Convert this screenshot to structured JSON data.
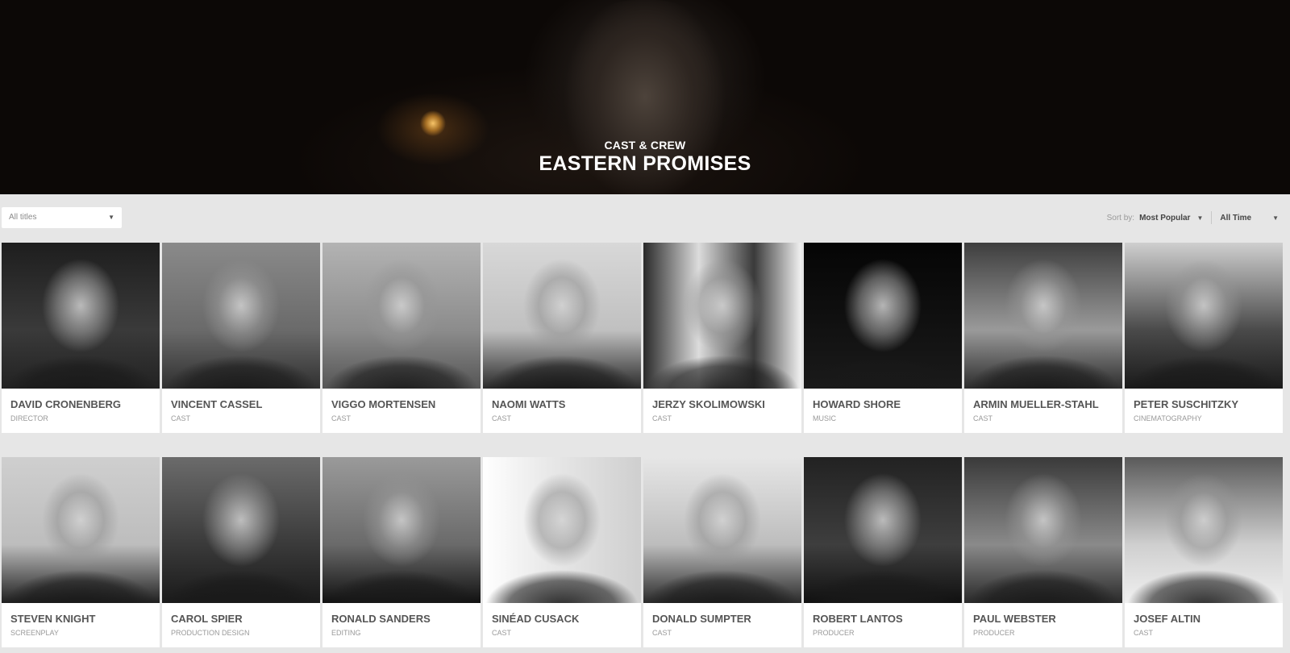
{
  "hero": {
    "subtitle": "CAST & CREW",
    "title": "EASTERN PROMISES"
  },
  "filters": {
    "titles_select": "All titles",
    "sort_label": "Sort by:",
    "sort_value": "Most Popular",
    "time_value": "All Time"
  },
  "people": [
    {
      "name": "DAVID CRONENBERG",
      "role": "DIRECTOR"
    },
    {
      "name": "VINCENT CASSEL",
      "role": "CAST"
    },
    {
      "name": "VIGGO MORTENSEN",
      "role": "CAST"
    },
    {
      "name": "NAOMI WATTS",
      "role": "CAST"
    },
    {
      "name": "JERZY SKOLIMOWSKI",
      "role": "CAST"
    },
    {
      "name": "HOWARD SHORE",
      "role": "MUSIC"
    },
    {
      "name": "ARMIN MUELLER-STAHL",
      "role": "CAST"
    },
    {
      "name": "PETER SUSCHITZKY",
      "role": "CINEMATOGRAPHY"
    },
    {
      "name": "STEVEN KNIGHT",
      "role": "SCREENPLAY"
    },
    {
      "name": "CAROL SPIER",
      "role": "PRODUCTION DESIGN"
    },
    {
      "name": "RONALD SANDERS",
      "role": "EDITING"
    },
    {
      "name": "SINÉAD CUSACK",
      "role": "CAST"
    },
    {
      "name": "DONALD SUMPTER",
      "role": "CAST"
    },
    {
      "name": "ROBERT LANTOS",
      "role": "PRODUCER"
    },
    {
      "name": "PAUL WEBSTER",
      "role": "PRODUCER"
    },
    {
      "name": "JOSEF ALTIN",
      "role": "CAST"
    }
  ],
  "icons": {
    "dropdown": "chevron-down-icon"
  }
}
